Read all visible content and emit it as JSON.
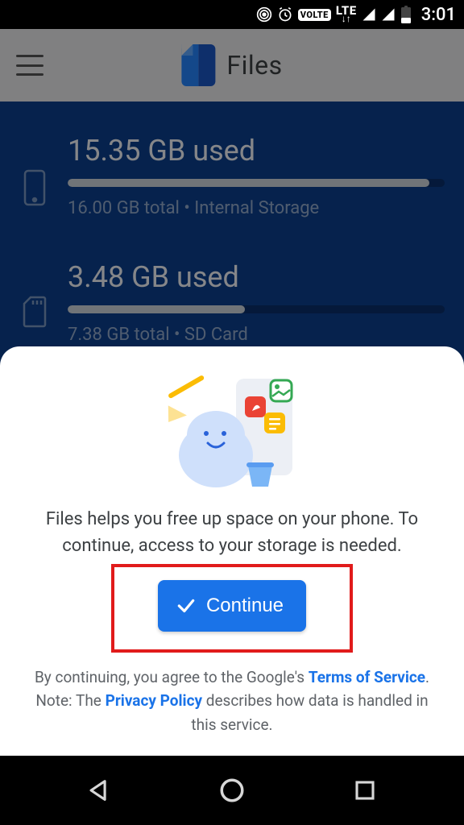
{
  "status_bar": {
    "volte": "VOLTE",
    "lte": "LTE",
    "time": "3:01"
  },
  "app_bar": {
    "title": "Files"
  },
  "storage": {
    "internal": {
      "used_text": "15.35 GB used",
      "sub_text": "16.00 GB total • Internal Storage",
      "fill_pct": 96
    },
    "sd": {
      "used_text": "3.48 GB used",
      "sub_text": "7.38 GB total • SD Card",
      "fill_pct": 47
    }
  },
  "sheet": {
    "message": "Files helps you free up space on your phone. To continue, access to your storage is needed.",
    "continue_label": "Continue",
    "legal_prefix": "By continuing, you agree to the Google's ",
    "tos": "Terms of Service",
    "legal_mid": ". Note: The ",
    "privacy": "Privacy Policy",
    "legal_suffix": " describes how data is handled in this service."
  }
}
